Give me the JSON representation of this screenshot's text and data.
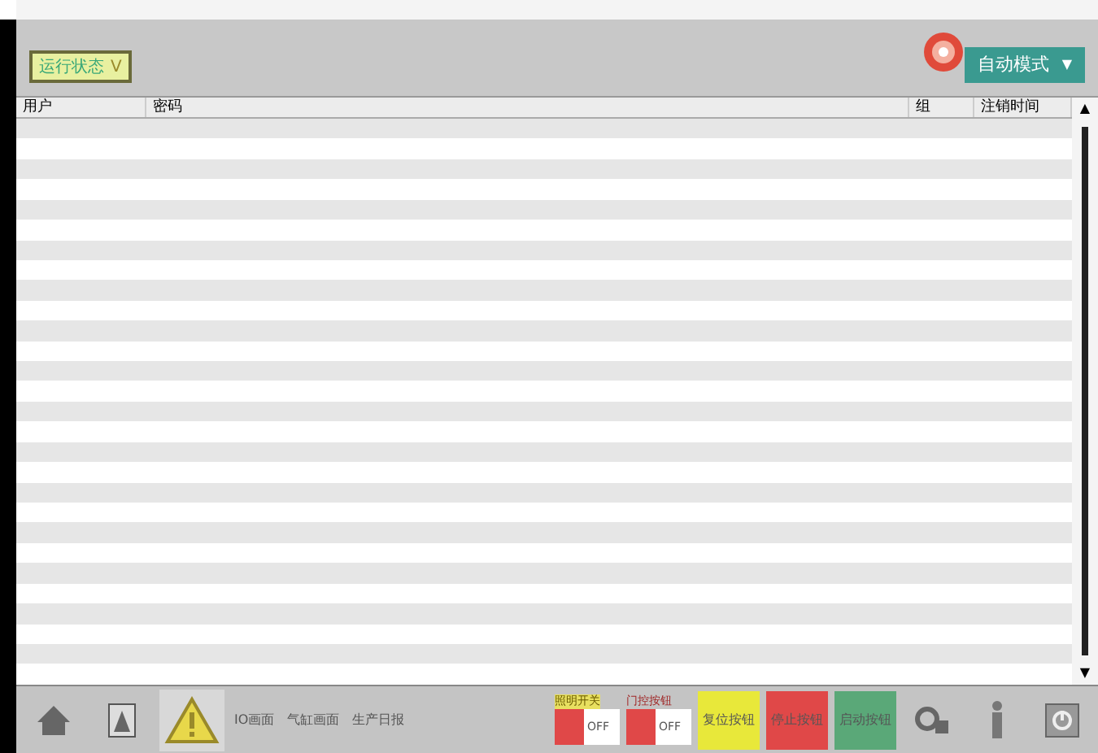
{
  "header": {
    "status_badge": {
      "label": "运行状态",
      "value": "V"
    },
    "mode_dropdown": {
      "label": "自动模式",
      "caret": "▼"
    }
  },
  "table": {
    "columns": [
      "用户",
      "密码",
      "组",
      "注销时间"
    ],
    "scroll_up": "▲",
    "scroll_down": "▼"
  },
  "footer": {
    "nav_buttons": [
      "IO画面",
      "气缸画面",
      "生产日报"
    ],
    "switches": [
      {
        "label": "照明开关",
        "state_text": "OFF",
        "on": false
      },
      {
        "label": "门控按钮",
        "state_text": "OFF",
        "on": false
      }
    ],
    "action_buttons": [
      {
        "label": "复位按钮",
        "color": "#e8e83a"
      },
      {
        "label": "停止按钮",
        "color": "#e04848"
      },
      {
        "label": "启动按钮",
        "color": "#5aa878"
      }
    ]
  }
}
